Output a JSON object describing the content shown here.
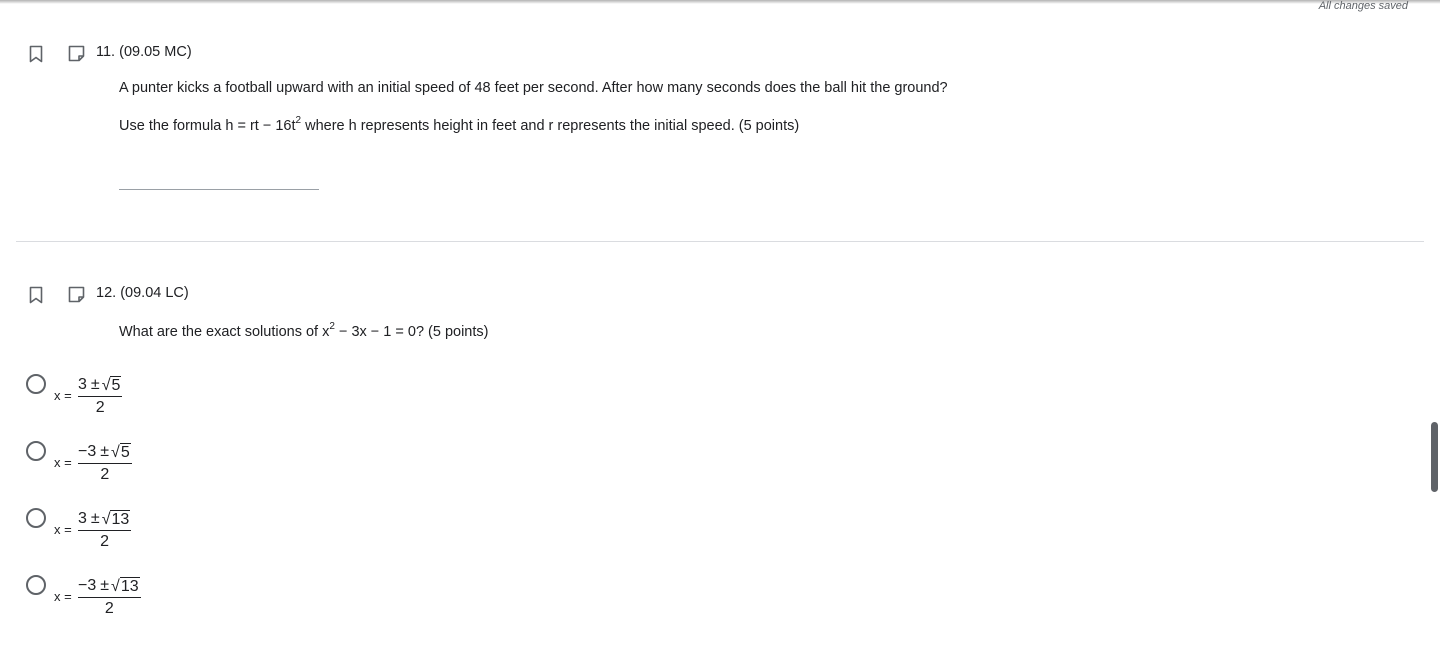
{
  "status": {
    "save_text": "All changes saved"
  },
  "questions": [
    {
      "number": "11.",
      "code": "(09.05 MC)",
      "line1": "A punter kicks a football upward with an initial speed of 48 feet per second. After how many seconds does the ball hit the ground?",
      "line2_pre": "Use the formula h = rt − 16t",
      "line2_sup": "2",
      "line2_post": " where h represents height in feet and r represents the initial speed. (5 points)",
      "answer_value": ""
    },
    {
      "number": "12.",
      "code": "(09.04 LC)",
      "text_pre": "What are the exact solutions of x",
      "text_sup": "2",
      "text_post": " − 3x − 1 = 0? (5 points)",
      "options": [
        {
          "prefix": "x =",
          "num_lead": "3",
          "pm": "±",
          "radicand": "5",
          "den": "2"
        },
        {
          "prefix": "x =",
          "num_lead": "−3",
          "pm": "±",
          "radicand": "5",
          "den": "2"
        },
        {
          "prefix": "x =",
          "num_lead": "3",
          "pm": "±",
          "radicand": "13",
          "den": "2"
        },
        {
          "prefix": "x =",
          "num_lead": "−3",
          "pm": "±",
          "radicand": "13",
          "den": "2"
        }
      ]
    }
  ],
  "icons": {
    "bookmark": "bookmark-icon",
    "note": "note-icon",
    "radio": "radio-button",
    "sqrt": "sqrt-symbol"
  },
  "colors": {
    "text": "#202124",
    "muted": "#5f6368",
    "divider": "#dadce0"
  }
}
